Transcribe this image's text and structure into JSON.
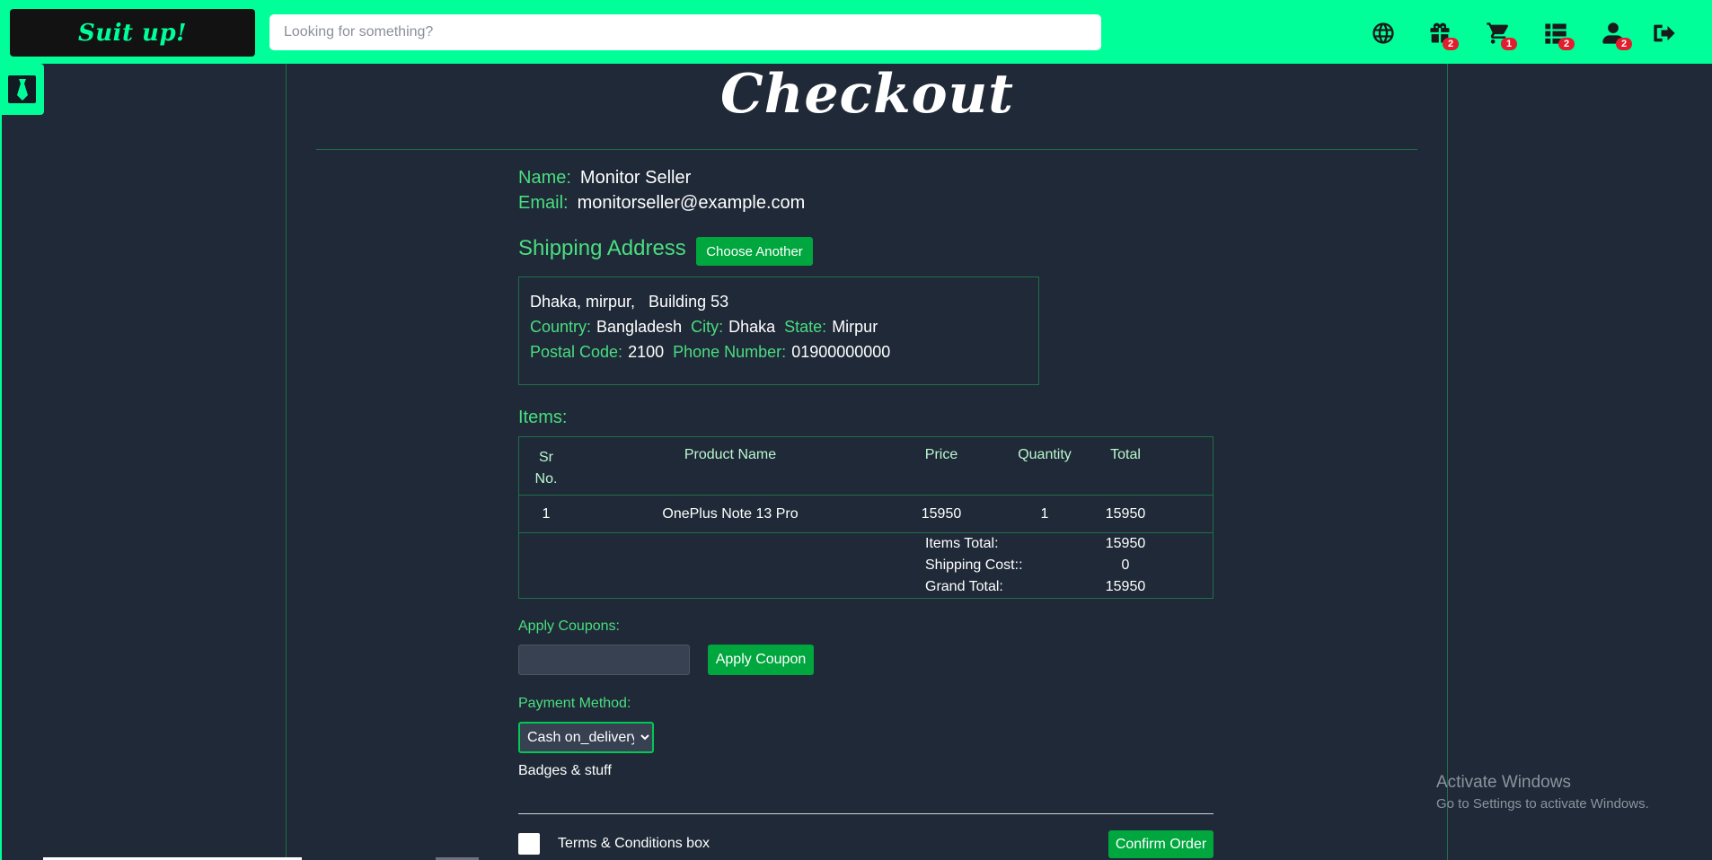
{
  "header": {
    "logo_text": "Suit up!",
    "search_placeholder": "Looking for something?",
    "icons": [
      {
        "name": "globe-icon",
        "badge": ""
      },
      {
        "name": "gift-icon",
        "badge": "2"
      },
      {
        "name": "cart-icon",
        "badge": "1"
      },
      {
        "name": "list-icon",
        "badge": "2"
      },
      {
        "name": "user-icon",
        "badge": "2"
      },
      {
        "name": "logout-icon",
        "badge": ""
      }
    ]
  },
  "sidebar": {
    "toggle_icon": "tie-icon"
  },
  "page": {
    "title": "Checkout"
  },
  "customer": {
    "name_label": "Name:",
    "name_value": "Monitor Seller",
    "email_label": "Email:",
    "email_value": "monitorseller@example.com"
  },
  "shipping": {
    "heading": "Shipping Address",
    "choose_button": "Choose Another",
    "address_line": "Dhaka, mirpur,   Building 53",
    "country_label": "Country:",
    "country_value": "Bangladesh",
    "city_label": "City:",
    "city_value": "Dhaka",
    "state_label": "State:",
    "state_value": "Mirpur",
    "postal_label": "Postal Code:",
    "postal_value": "2100",
    "phone_label": "Phone Number:",
    "phone_value": "01900000000"
  },
  "items": {
    "heading": "Items:",
    "columns": [
      "Sr No.",
      "Product Name",
      "Price",
      "Quantity",
      "Total"
    ],
    "rows": [
      {
        "sr": "1",
        "product": "OnePlus Note 13 Pro",
        "price": "15950",
        "quantity": "1",
        "total": "15950"
      }
    ],
    "items_total_label": "Items Total:",
    "items_total_value": "15950",
    "shipping_cost_label": "Shipping Cost::",
    "shipping_cost_value": "0",
    "grand_total_label": "Grand Total:",
    "grand_total_value": "15950"
  },
  "coupon": {
    "label": "Apply Coupons:",
    "input_value": "",
    "button": "Apply Coupon"
  },
  "payment": {
    "label": "Payment Method:",
    "selected": "Cash on_delivery"
  },
  "badges_text": "Badges & stuff",
  "terms": {
    "label": "Terms & Conditions box",
    "confirm_button": "Confirm Order"
  },
  "watermark": {
    "line1": "Activate Windows",
    "line2": "Go to Settings to activate Windows."
  },
  "colors": {
    "accent": "#00ff99",
    "background": "#1f2937",
    "label": "#4ade80",
    "button": "#00a63e",
    "badge": "#e11d2e"
  }
}
